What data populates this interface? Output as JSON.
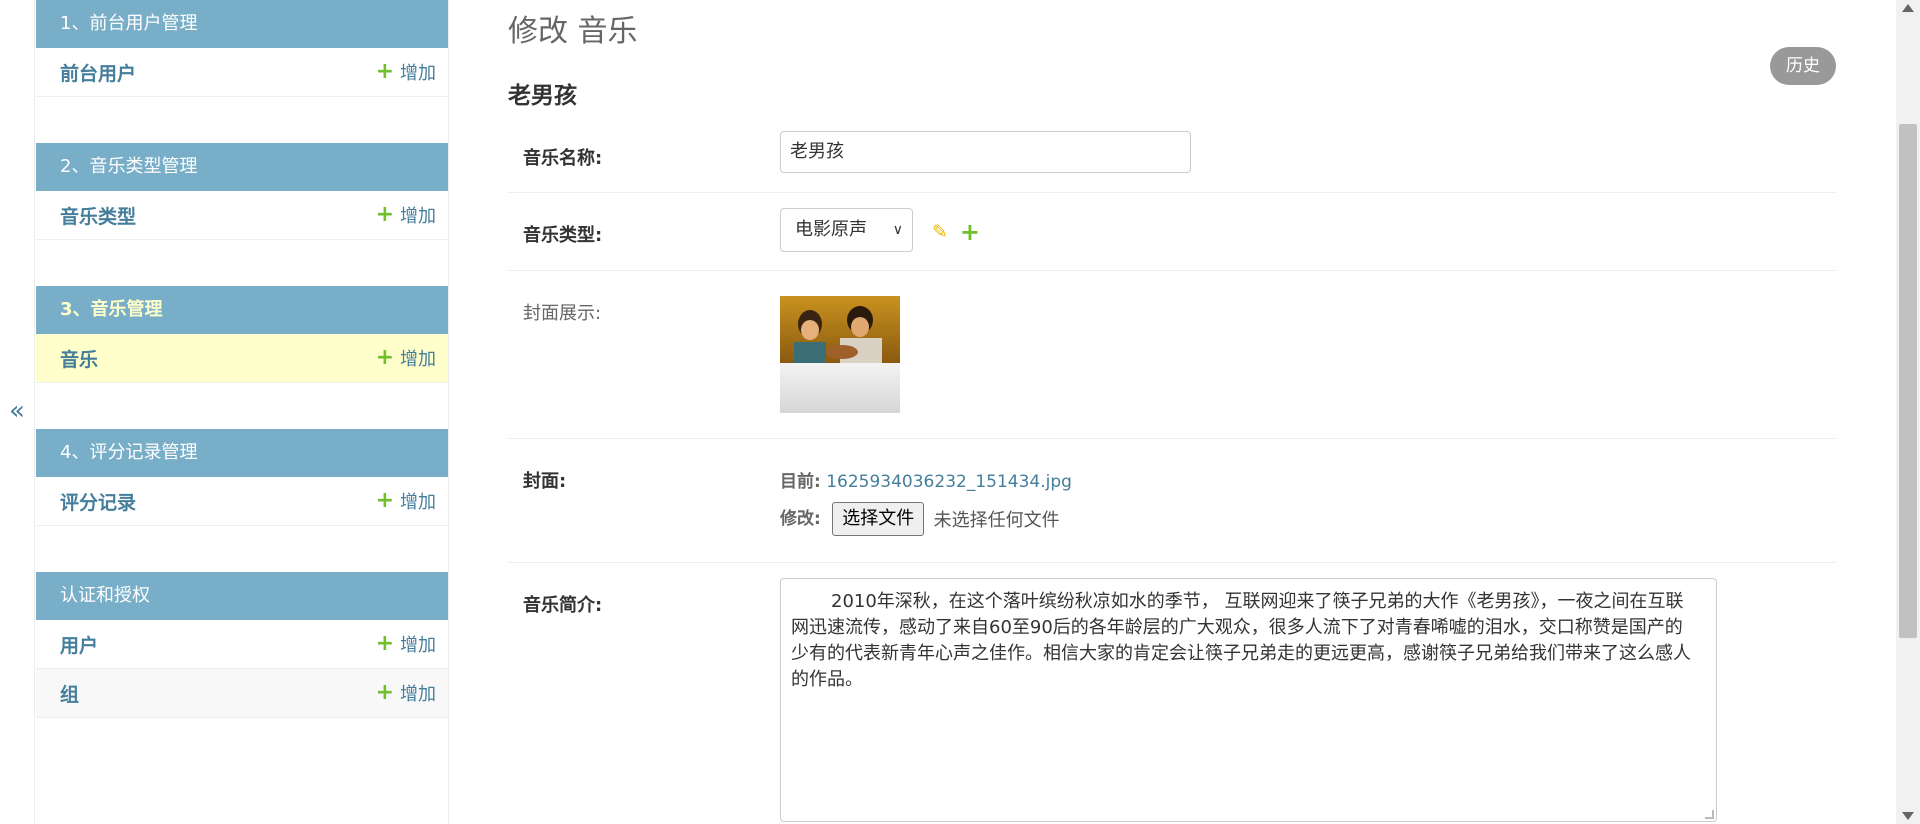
{
  "nav_toggle": "«",
  "sidebar": {
    "modules": [
      {
        "caption": "1、前台用户管理",
        "current": false,
        "models": [
          {
            "name": "前台用户",
            "add": "增加",
            "current": false
          }
        ]
      },
      {
        "caption": "2、音乐类型管理",
        "current": false,
        "models": [
          {
            "name": "音乐类型",
            "add": "增加",
            "current": false
          }
        ]
      },
      {
        "caption": "3、音乐管理",
        "current": true,
        "models": [
          {
            "name": "音乐",
            "add": "增加",
            "current": true
          }
        ]
      },
      {
        "caption": "4、评分记录管理",
        "current": false,
        "models": [
          {
            "name": "评分记录",
            "add": "增加",
            "current": false
          }
        ]
      },
      {
        "caption": "认证和授权",
        "current": false,
        "models": [
          {
            "name": "用户",
            "add": "增加",
            "current": false
          },
          {
            "name": "组",
            "add": "增加",
            "current": false
          }
        ]
      }
    ]
  },
  "content": {
    "title": "修改 音乐",
    "history_label": "历史",
    "object_title": "老男孩",
    "fields": {
      "name_label": "音乐名称:",
      "name_value": "老男孩",
      "type_label": "音乐类型:",
      "type_value": "电影原声",
      "cover_display_label": "封面展示:",
      "cover_label": "封面:",
      "current_label": "目前:",
      "current_file": "1625934036232_151434.jpg",
      "change_label": "修改:",
      "choose_file": "选择文件",
      "no_file": "未选择任何文件",
      "intro_label": "音乐简介:",
      "intro_value": "2010年深秋，在这个落叶缤纷秋凉如水的季节， 互联网迎来了筷子兄弟的大作《老男孩》，一夜之间在互联网迅速流传，感动了来自60至90后的各年龄层的广大观众，很多人流下了对青春唏嘘的泪水，交口称赞是国产的少有的代表新青年心声之佳作。相信大家的肯定会让筷子兄弟走的更远更高，感谢筷子兄弟给我们带来了这么感人的作品。"
    }
  },
  "colors": {
    "header_blue": "#79aec8",
    "link_blue": "#447e9b",
    "add_green": "#70bf2b",
    "current_yellow": "#ffffcc",
    "pencil_yellow": "#efb80b"
  }
}
